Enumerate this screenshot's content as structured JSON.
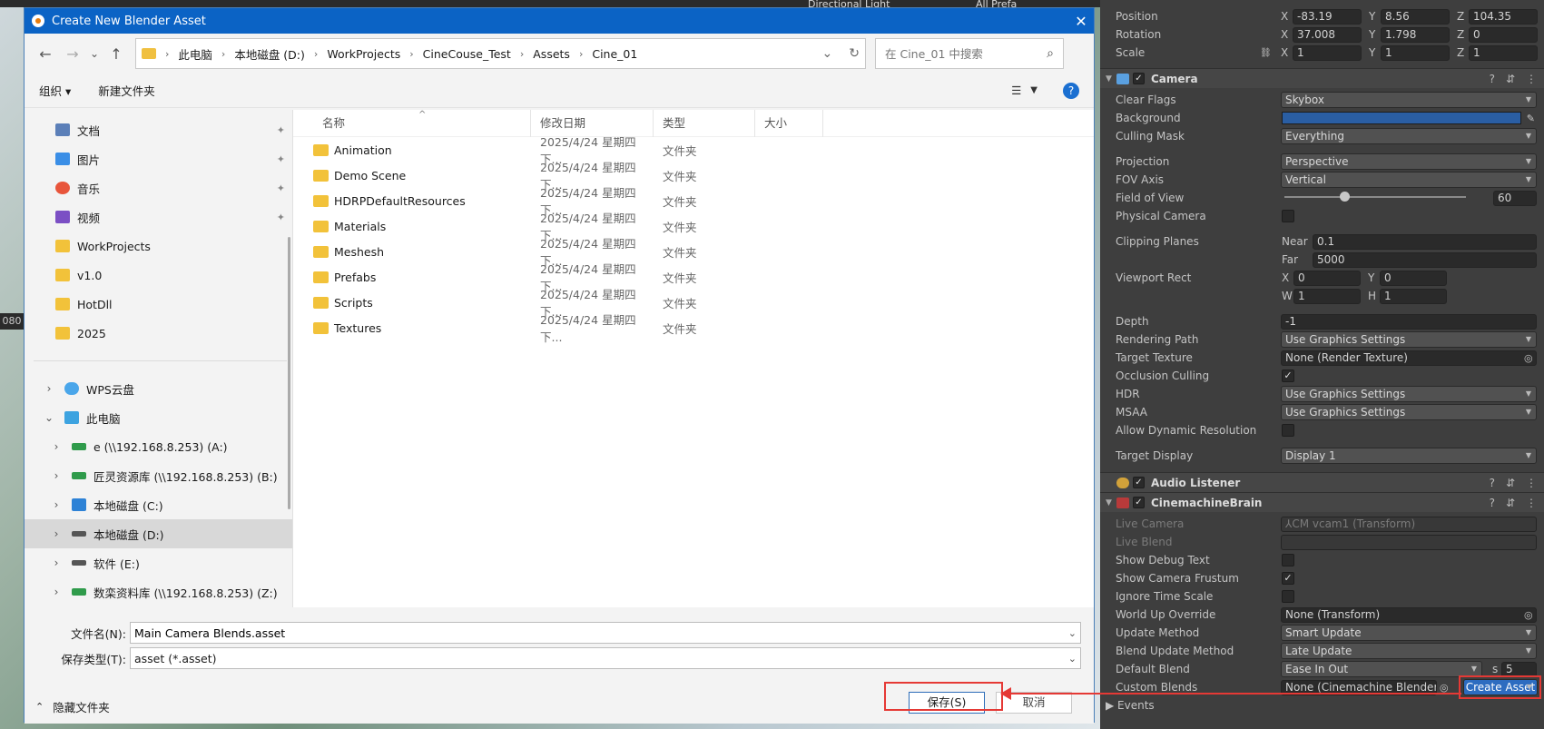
{
  "scene": {
    "top_items": [
      "Directional Light",
      "All Prefa"
    ],
    "side_label": "080"
  },
  "dialog": {
    "title": "Create New Blender Asset",
    "close": "✕",
    "breadcrumb": [
      "此电脑",
      "本地磁盘 (D:)",
      "WorkProjects",
      "CineCouse_Test",
      "Assets",
      "Cine_01"
    ],
    "search_placeholder": "在 Cine_01 中搜索",
    "toolbar": {
      "organize": "组织 ▾",
      "new_folder": "新建文件夹"
    },
    "sidebar": {
      "quick": [
        {
          "label": "文档",
          "icon": "documents-icon",
          "pinned": true
        },
        {
          "label": "图片",
          "icon": "pictures-icon",
          "pinned": true
        },
        {
          "label": "音乐",
          "icon": "music-icon",
          "pinned": true
        },
        {
          "label": "视频",
          "icon": "videos-icon",
          "pinned": true
        },
        {
          "label": "WorkProjects",
          "icon": "folder-icon",
          "pinned": false
        },
        {
          "label": "v1.0",
          "icon": "folder-icon",
          "pinned": false
        },
        {
          "label": "HotDll",
          "icon": "folder-icon",
          "pinned": false
        },
        {
          "label": "2025",
          "icon": "folder-icon",
          "pinned": false
        }
      ],
      "tree": [
        {
          "label": "WPS云盘",
          "chev": "›",
          "indent": 0,
          "icon": "cloud-icon"
        },
        {
          "label": "此电脑",
          "chev": "⌄",
          "indent": 0,
          "icon": "pc-icon"
        },
        {
          "label": "e (\\\\192.168.8.253) (A:)",
          "chev": "›",
          "indent": 1,
          "icon": "network-drive-icon"
        },
        {
          "label": "匠灵资源库 (\\\\192.168.8.253) (B:)",
          "chev": "›",
          "indent": 1,
          "icon": "network-drive-icon"
        },
        {
          "label": "本地磁盘 (C:)",
          "chev": "›",
          "indent": 1,
          "icon": "windows-drive-icon"
        },
        {
          "label": "本地磁盘 (D:)",
          "chev": "›",
          "indent": 1,
          "icon": "drive-icon",
          "selected": true
        },
        {
          "label": "软件 (E:)",
          "chev": "›",
          "indent": 1,
          "icon": "drive-icon"
        },
        {
          "label": "数栾资料库 (\\\\192.168.8.253) (Z:)",
          "chev": "›",
          "indent": 1,
          "icon": "network-drive-icon"
        }
      ]
    },
    "columns": {
      "name": "名称",
      "date": "修改日期",
      "type": "类型",
      "size": "大小"
    },
    "files": [
      {
        "name": "Animation",
        "date": "2025/4/24 星期四 下...",
        "type": "文件夹"
      },
      {
        "name": "Demo Scene",
        "date": "2025/4/24 星期四 下...",
        "type": "文件夹"
      },
      {
        "name": "HDRPDefaultResources",
        "date": "2025/4/24 星期四 下...",
        "type": "文件夹"
      },
      {
        "name": "Materials",
        "date": "2025/4/24 星期四 下...",
        "type": "文件夹"
      },
      {
        "name": "Meshesh",
        "date": "2025/4/24 星期四 下...",
        "type": "文件夹"
      },
      {
        "name": "Prefabs",
        "date": "2025/4/24 星期四 下...",
        "type": "文件夹"
      },
      {
        "name": "Scripts",
        "date": "2025/4/24 星期四 下...",
        "type": "文件夹"
      },
      {
        "name": "Textures",
        "date": "2025/4/24 星期四 下...",
        "type": "文件夹"
      }
    ],
    "filename_label": "文件名(N):",
    "filename_value": "Main Camera Blends.asset",
    "filetype_label": "保存类型(T):",
    "filetype_value": "asset (*.asset)",
    "hide_folders": "隐藏文件夹",
    "save": "保存(S)",
    "cancel": "取消"
  },
  "inspector": {
    "transform": {
      "position": {
        "label": "Position",
        "x": "-83.19",
        "y": "8.56",
        "z": "104.35"
      },
      "rotation": {
        "label": "Rotation",
        "x": "37.008",
        "y": "1.798",
        "z": "0"
      },
      "scale": {
        "label": "Scale",
        "x": "1",
        "y": "1",
        "z": "1"
      }
    },
    "camera": {
      "title": "Camera",
      "clear_flags": {
        "label": "Clear Flags",
        "value": "Skybox"
      },
      "background": {
        "label": "Background",
        "color": "#2a5ea3"
      },
      "culling_mask": {
        "label": "Culling Mask",
        "value": "Everything"
      },
      "projection": {
        "label": "Projection",
        "value": "Perspective"
      },
      "fov_axis": {
        "label": "FOV Axis",
        "value": "Vertical"
      },
      "fov": {
        "label": "Field of View",
        "value": "60",
        "fraction": 0.33
      },
      "physical": {
        "label": "Physical Camera"
      },
      "clipping": {
        "label": "Clipping Planes",
        "near_label": "Near",
        "near": "0.1",
        "far_label": "Far",
        "far": "5000"
      },
      "viewport": {
        "label": "Viewport Rect",
        "x": "0",
        "y": "0",
        "w": "1",
        "h": "1"
      },
      "depth": {
        "label": "Depth",
        "value": "-1"
      },
      "rendering_path": {
        "label": "Rendering Path",
        "value": "Use Graphics Settings"
      },
      "target_texture": {
        "label": "Target Texture",
        "value": "None (Render Texture)"
      },
      "occlusion": {
        "label": "Occlusion Culling"
      },
      "hdr": {
        "label": "HDR",
        "value": "Use Graphics Settings"
      },
      "msaa": {
        "label": "MSAA",
        "value": "Use Graphics Settings"
      },
      "dyn_res": {
        "label": "Allow Dynamic Resolution"
      },
      "target_display": {
        "label": "Target Display",
        "value": "Display 1"
      }
    },
    "audio_listener": {
      "title": "Audio Listener"
    },
    "brain": {
      "title": "CinemachineBrain",
      "live_camera": {
        "label": "Live Camera",
        "value": "⅄CM vcam1 (Transform)"
      },
      "live_blend": {
        "label": "Live Blend"
      },
      "debug_text": {
        "label": "Show Debug Text"
      },
      "frustum": {
        "label": "Show Camera Frustum"
      },
      "ignore_ts": {
        "label": "Ignore Time Scale"
      },
      "world_up": {
        "label": "World Up Override",
        "value": "None (Transform)"
      },
      "update_method": {
        "label": "Update Method",
        "value": "Smart Update"
      },
      "blend_update": {
        "label": "Blend Update Method",
        "value": "Late Update"
      },
      "default_blend": {
        "label": "Default Blend",
        "value": "Ease In Out",
        "s_label": "s",
        "s_value": "5"
      },
      "custom_blends": {
        "label": "Custom Blends",
        "value": "None (Cinemachine Blender Se",
        "button": "Create Asset"
      },
      "events": {
        "label": "Events"
      }
    }
  }
}
